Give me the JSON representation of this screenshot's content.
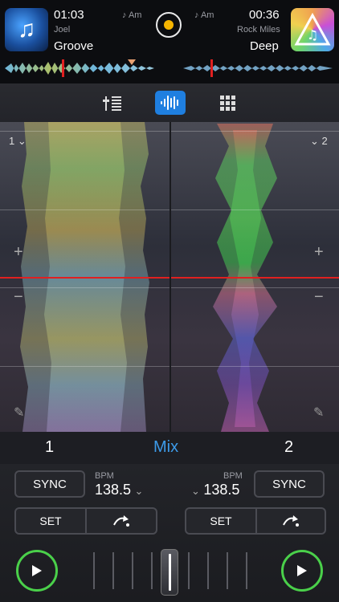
{
  "deck_left": {
    "time": "01:03",
    "key": "♪ Am",
    "artist": "Joel",
    "title": "Groove",
    "number": "1",
    "number_label": "1",
    "chevron": "⌄"
  },
  "deck_right": {
    "time": "00:36",
    "key": "♪ Am",
    "artist": "Rock Miles",
    "title": "Deep",
    "number": "2",
    "number_label": "2",
    "chevron": "⌄"
  },
  "modes": {
    "eq_icon": "eq-sliders-icon",
    "waveform_icon": "waveform-icon",
    "pads_icon": "grid-pads-icon",
    "active": "waveform"
  },
  "waveform": {
    "plus": "+",
    "minus": "−"
  },
  "mixer": {
    "mix_label": "Mix"
  },
  "left_controls": {
    "sync": "SYNC",
    "bpm_label": "BPM",
    "bpm_value": "138.5",
    "set": "SET"
  },
  "right_controls": {
    "sync": "SYNC",
    "bpm_label": "BPM",
    "bpm_value": "138.5",
    "set": "SET"
  },
  "colors": {
    "accent": "#1f7fe0",
    "play_ring": "#4ad04a",
    "center_dot": "#f5b400",
    "mix_text": "#3d9be9"
  }
}
